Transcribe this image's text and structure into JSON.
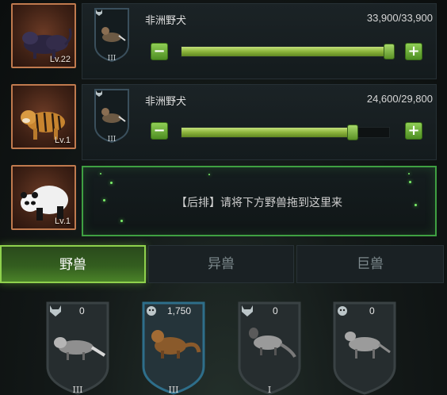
{
  "team": [
    {
      "level": "Lv.22",
      "portrait_icon": "black-panther-icon",
      "beast_name": "非洲野犬",
      "hp": "33,900/33,900",
      "hp_fraction": 1.0,
      "rank": "III",
      "minus": "−",
      "plus": "+"
    },
    {
      "level": "Lv.1",
      "portrait_icon": "tiger-icon",
      "beast_name": "非洲野犬",
      "hp": "24,600/29,800",
      "hp_fraction": 0.8255,
      "rank": "III",
      "minus": "−",
      "plus": "+"
    },
    {
      "level": "Lv.1",
      "portrait_icon": "panda-icon",
      "slot_hint": "【后排】请将下方野兽拖到这里来"
    }
  ],
  "tabs": [
    {
      "label": "野兽",
      "active": true
    },
    {
      "label": "异兽",
      "active": false
    },
    {
      "label": "巨兽",
      "active": false
    }
  ],
  "cards": [
    {
      "count": "0",
      "rank": "III",
      "type_icon": "wolf-icon",
      "animal_icon": "raccoon-dog-icon",
      "frame_color": "#3a4244"
    },
    {
      "count": "1,750",
      "rank": "III",
      "type_icon": "monkey-icon",
      "animal_icon": "mongoose-icon",
      "frame_color": "#2e6e8a"
    },
    {
      "count": "0",
      "rank": "I",
      "type_icon": "wolf-icon",
      "animal_icon": "civet-icon",
      "frame_color": "#3a4244"
    },
    {
      "count": "0",
      "rank": "",
      "type_icon": "monkey-icon",
      "animal_icon": "hyena-icon",
      "frame_color": "#3a4244"
    }
  ],
  "colors": {
    "accent_green": "#8fd14d",
    "portrait_border": "#c07a4e",
    "slot_border": "#3fa042"
  }
}
